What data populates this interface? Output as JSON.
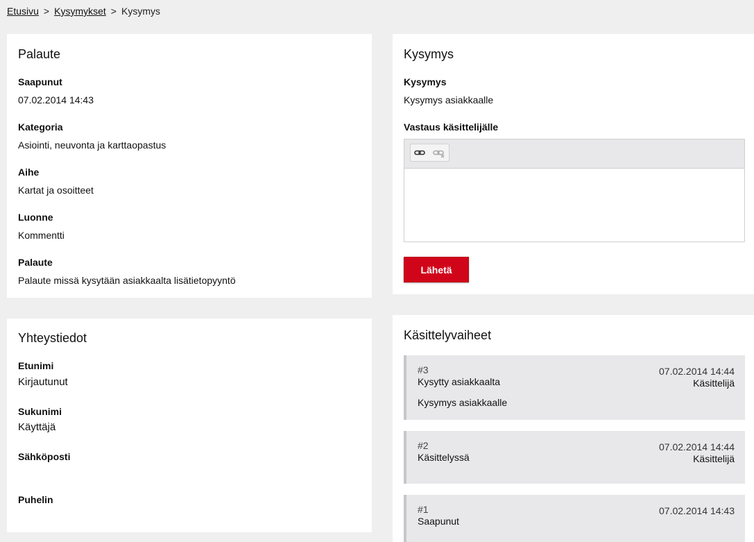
{
  "breadcrumb": {
    "home": "Etusivu",
    "questions": "Kysymykset",
    "current": "Kysymys",
    "separator": ">"
  },
  "feedback": {
    "title": "Palaute",
    "fields": [
      {
        "label": "Saapunut",
        "value": "07.02.2014 14:43"
      },
      {
        "label": "Kategoria",
        "value": "Asiointi, neuvonta ja karttaopastus"
      },
      {
        "label": "Aihe",
        "value": "Kartat ja osoitteet"
      },
      {
        "label": "Luonne",
        "value": "Kommentti"
      },
      {
        "label": "Palaute",
        "value": "Palaute missä kysytään asiakkaalta lisätietopyyntö"
      }
    ]
  },
  "contact": {
    "title": "Yhteystiedot",
    "fields": [
      {
        "label": "Etunimi",
        "value": "Kirjautunut"
      },
      {
        "label": "Sukunimi",
        "value": "Käyttäjä"
      },
      {
        "label": "Sähköposti",
        "value": ""
      },
      {
        "label": "Puhelin",
        "value": ""
      }
    ]
  },
  "question": {
    "title": "Kysymys",
    "question_label": "Kysymys",
    "question_value": "Kysymys asiakkaalle",
    "answer_label": "Vastaus käsittelijälle",
    "answer_value": "",
    "toolbar": [
      "link-icon",
      "unlink-icon"
    ],
    "send_label": "Lähetä"
  },
  "colors": {
    "accent": "#d1051a",
    "background": "#efefef",
    "step_background": "#e8e8ea"
  },
  "steps": {
    "title": "Käsittelyvaiheet",
    "items": [
      {
        "number": "#3",
        "status": "Kysytty asiakkaalta",
        "date": "07.02.2014 14:44",
        "handler": "Käsittelijä",
        "message": "Kysymys asiakkaalle"
      },
      {
        "number": "#2",
        "status": "Käsittelyssä",
        "date": "07.02.2014 14:44",
        "handler": "Käsittelijä",
        "message": ""
      },
      {
        "number": "#1",
        "status": "Saapunut",
        "date": "07.02.2014 14:43",
        "handler": "",
        "message": ""
      }
    ]
  }
}
